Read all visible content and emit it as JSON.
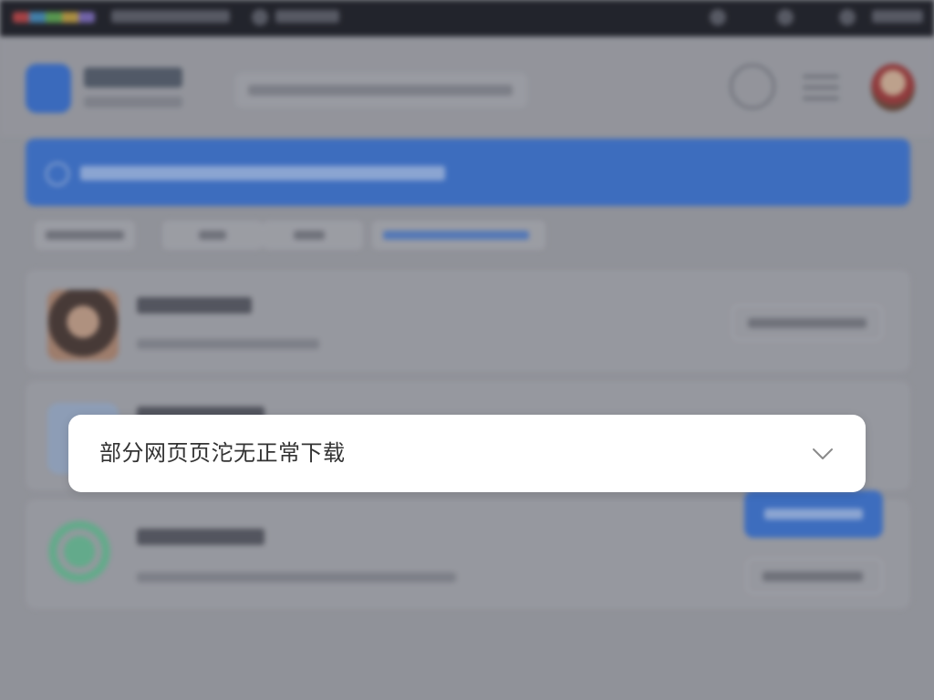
{
  "notice": {
    "text": "部分网页页沱无正常下载"
  },
  "icons": {
    "expand": "chevron-down-icon",
    "app_logo": "app-logo-icon",
    "refresh": "refresh-icon",
    "menu": "menu-icon",
    "user": "avatar",
    "link": "link-icon"
  },
  "colors": {
    "accent": "#3e78d8",
    "notice_bg": "#ffffff",
    "notice_text": "#333333",
    "chevron": "#8a8a8a"
  }
}
